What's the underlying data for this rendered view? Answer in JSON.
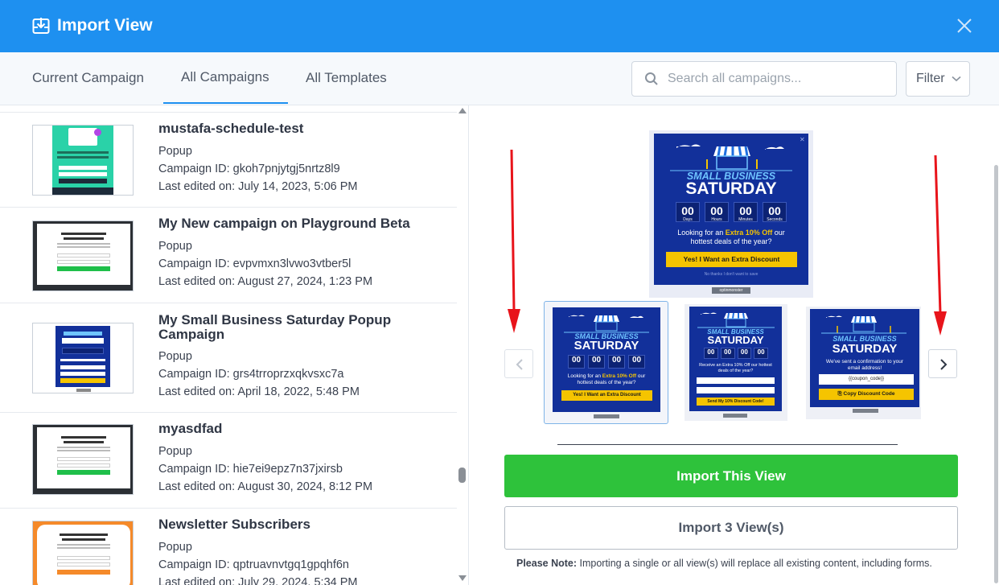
{
  "header": {
    "title": "Import View",
    "accent": "#1e90f0"
  },
  "tabs": [
    {
      "label": "Current Campaign"
    },
    {
      "label": "All Campaigns",
      "active": true
    },
    {
      "label": "All Templates"
    }
  ],
  "search": {
    "placeholder": "Search all campaigns..."
  },
  "filter": {
    "label": "Filter"
  },
  "campaigns": [
    {
      "name": "mustafa-schedule-test",
      "type": "Popup",
      "id": "Campaign ID: gkoh7pnjytgj5nrtz8l9",
      "edited": "Last edited on: July 14, 2023, 5:06 PM"
    },
    {
      "name": "My New campaign on Playground Beta",
      "type": "Popup",
      "id": "Campaign ID: evpvmxn3lvwo3vtber5l",
      "edited": "Last edited on: August 27, 2024, 1:23 PM"
    },
    {
      "name": "My Small Business Saturday Popup Campaign",
      "type": "Popup",
      "id": "Campaign ID: grs4trroprzxqkvsxc7a",
      "edited": "Last edited on: April 18, 2022, 5:48 PM"
    },
    {
      "name": "myasdfad",
      "type": "Popup",
      "id": "Campaign ID: hie7ei9epz7n37jxirsb",
      "edited": "Last edited on: August 30, 2024, 8:12 PM"
    },
    {
      "name": "Newsletter Subscribers",
      "type": "Popup",
      "id": "Campaign ID: qptruavnvtgq1gpqhf6n",
      "edited": "Last edited on: July 29, 2024, 5:34 PM"
    }
  ],
  "preview": {
    "line1": "SMALL BUSINESS",
    "line2": "SATURDAY",
    "timer": [
      "00",
      "00",
      "00",
      "00"
    ],
    "timer_labels": [
      "Days",
      "Hours",
      "Minutes",
      "Seconds"
    ],
    "offer_text_a": "Looking for an ",
    "offer_highlight": "Extra 10% Off",
    "offer_text_b": " our hottest deals of the year?",
    "cta": "Yes! I Want an Extra Discount",
    "no_thanks": "No thanks I don't want to save",
    "badge": "optinmonster"
  },
  "thumbnails": [
    {
      "cta": "Yes! I Want an Extra Discount",
      "text": "Looking for an Extra 10% Off our hottest deals of the year?"
    },
    {
      "cta": "Send My 10% Discount Code!",
      "text": "Receive an Extra 10% Off our hottest deals of the year?"
    },
    {
      "cta": "Copy Discount Code",
      "text": "We've sent a confirmation to your email address!",
      "code": "{{coupon_code}}"
    }
  ],
  "actions": {
    "import_one": "Import This View",
    "import_all": "Import 3 View(s)"
  },
  "note": {
    "bold": "Please Note:",
    "text": " Importing a single or all view(s) will replace all existing content, including forms."
  },
  "colors": {
    "green": "#2ec23b",
    "popup_blue": "#12309a",
    "yellow": "#f5c400",
    "red_arrow": "#e8141b"
  }
}
